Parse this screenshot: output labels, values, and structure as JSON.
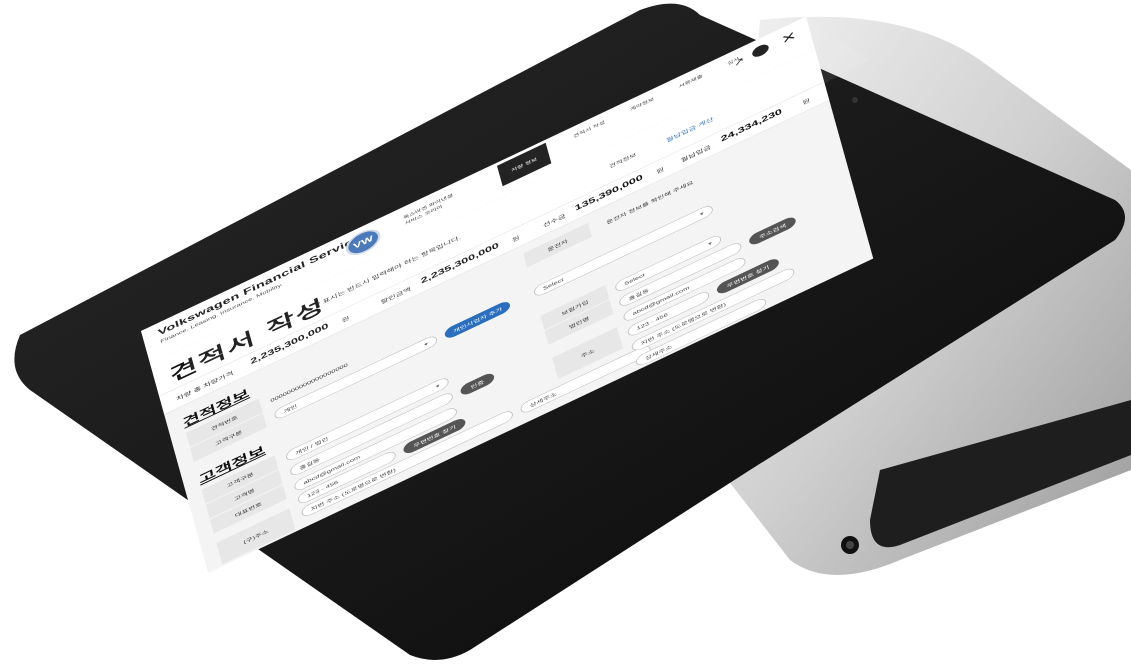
{
  "app": {
    "brand": "Volkswagen Financial Services",
    "brand_sub": "Finance. Leasing. Insurance. Mobility.",
    "logo_text": "VW"
  },
  "topbar": {
    "dealer_line1": "폭스바겐 파이낸셜",
    "dealer_line2": "서비스 코리아",
    "black_box": "차량 정보",
    "step1": "견적서 작성",
    "step2": "계약정보",
    "step3": "서류제출",
    "step4": "심사",
    "icon_share": "share-icon",
    "icon_close": "close-icon"
  },
  "title": {
    "page_title": "견적서 작성",
    "note": "* 표시는 반드시 입력해야 하는 항목입니다."
  },
  "summary": {
    "vehicle_price_label": "차량 총 차량가격",
    "vehicle_price": "2,235,300,000",
    "discount_label": "할인금액",
    "discount_amount": "2,235,300,000",
    "prepay_label": "선수금",
    "prepay_amount": "135,390,000",
    "monthly_label": "월납입금",
    "monthly_amount": "24,334,230",
    "unit": "원",
    "tab_estimate": "견적정보",
    "tab_calc": "월납입금 계산"
  },
  "estimate_section": {
    "title": "견적정보",
    "row1_label": "견적번호",
    "row1_value": "0000000000000000000",
    "row2_label": "고객구분",
    "select_type": "개인",
    "btn_add": "개인사업자 추가"
  },
  "customer_section": {
    "title": "고객정보",
    "type_label": "고객구분",
    "name_label": "고객명",
    "phone_label": "대표번호",
    "address_label": "(구)주소",
    "individual_option": "개인 / 법인",
    "name_value": "홍길동",
    "email_value": "abcd@gmail.com",
    "phone_value": "123 - 456",
    "address_value": "지번 주소 (도로명으로 변환)",
    "detail_address": "상세주소",
    "btn_search": "주소검색",
    "btn_verify": "인증",
    "btn_find": "우편번호 찾기"
  },
  "right_panel": {
    "label1": "운전자",
    "label2": "보험가입",
    "label3": "법인명",
    "label4": "주소",
    "select1": "Select",
    "select2": "Select",
    "value1": "홍길동",
    "value2": "abcd@gmail.com",
    "value3": "123 - 456",
    "address": "지번 주소 (도로명으로 변환)",
    "detail": "상세주소",
    "btn1": "주소검색",
    "btn2": "우편번호 찾기",
    "text_note": "운전자 정보를 확인해 주세요"
  },
  "colors": {
    "accent": "#2a6ec0",
    "bezel": "#111111",
    "silver": "#c8c8c8"
  }
}
